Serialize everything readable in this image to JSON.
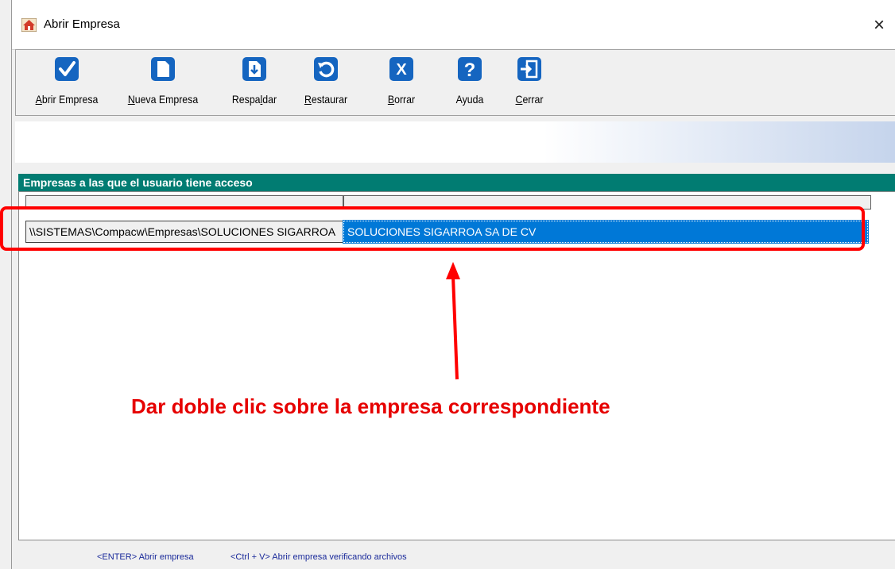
{
  "window": {
    "title": "Abrir Empresa",
    "close_glyph": "×"
  },
  "toolbar": {
    "buttons": [
      {
        "icon": "check-icon",
        "label_pre": "",
        "label_key": "A",
        "label_post": "brir Empresa"
      },
      {
        "icon": "new-document-icon",
        "label_pre": "",
        "label_key": "N",
        "label_post": "ueva Empresa"
      },
      {
        "icon": "backup-icon",
        "label_pre": "Respa",
        "label_key": "l",
        "label_post": "dar"
      },
      {
        "icon": "restore-icon",
        "label_pre": "",
        "label_key": "R",
        "label_post": "estaurar"
      },
      {
        "icon": "delete-icon",
        "label_pre": "",
        "label_key": "B",
        "label_post": "orrar"
      },
      {
        "icon": "help-icon",
        "label_pre": "Ayuda",
        "label_key": "",
        "label_post": ""
      },
      {
        "icon": "exit-icon",
        "label_pre": "",
        "label_key": "C",
        "label_post": "errar"
      }
    ]
  },
  "grid": {
    "header": "Empresas a las que el usuario tiene acceso",
    "rows": [
      {
        "path": "\\\\SISTEMAS\\Compacw\\Empresas\\SOLUCIONES SIGARROA",
        "name": "SOLUCIONES SIGARROA SA DE CV"
      }
    ]
  },
  "annotation": {
    "text": "Dar doble clic sobre la empresa correspondiente",
    "color": "#e60000"
  },
  "status": {
    "enter": "<ENTER> Abrir empresa",
    "ctrl_v": "<Ctrl + V> Abrir empresa verificando archivos"
  },
  "colors": {
    "accent": "#0078d7",
    "grid_header": "#017c72",
    "highlight": "#ff0000"
  }
}
